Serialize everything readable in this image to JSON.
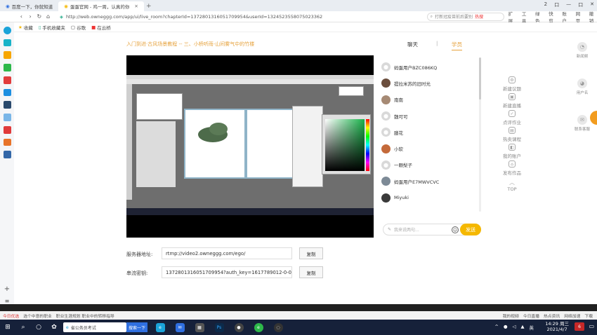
{
  "browser": {
    "tabs": [
      {
        "label": "百度一下，你就知道",
        "active": false
      },
      {
        "label": "蛋蛋官网 - 鸡一周，认真的你",
        "active": true
      }
    ],
    "window_controls": [
      "2",
      "口",
      "—",
      "口",
      "✕"
    ],
    "url": "http://web.owneggg.com/app/ui/live_room?chapterId=1372801316051709954&userId=1324523558075023362",
    "search_placeholder": "打新冠疫苗前后要别",
    "search_tag": "热搜",
    "toolbar_items": [
      "扩展",
      "工具",
      "绿色",
      "快剪",
      "账户",
      "网页",
      "撤销"
    ],
    "bookmarks": [
      "收藏",
      "手机收藏夹",
      "谷歌",
      "在云桥"
    ]
  },
  "lesson": {
    "title": "入门到进·古风场景教程 -- 三、小桥听雨-山间雾气中的竹楼",
    "tabs": {
      "chat": "聊天",
      "separator": "|",
      "students": "学员"
    }
  },
  "students": [
    {
      "name": "蚂蛋用户BZC086KQ",
      "avatar_color": "#d9d9d9"
    },
    {
      "name": "提拉米苏的旧时光",
      "avatar_color": "#6b4e3d"
    },
    {
      "name": "南南",
      "avatar_color": "#a68a74"
    },
    {
      "name": "魏可可",
      "avatar_color": "#d9d9d9"
    },
    {
      "name": "膳花",
      "avatar_color": "#d9d9d9"
    },
    {
      "name": "小软",
      "avatar_color": "#c46a3a"
    },
    {
      "name": "一颗梨子",
      "avatar_color": "#d9d9d9"
    },
    {
      "name": "蚂蛋用户E7MWVCVC",
      "avatar_color": "#7d8a96"
    },
    {
      "name": "Miyuki",
      "avatar_color": "#3a3a3a"
    }
  ],
  "chat_input": {
    "placeholder": "我来说两句...",
    "send_label": "发送",
    "emoji": "☺"
  },
  "right_menu": [
    {
      "label": "新建议题",
      "icon": "gear-icon",
      "glyph": "⚙"
    },
    {
      "label": "新建直播",
      "icon": "live-icon",
      "glyph": "▣"
    },
    {
      "label": "点评作业",
      "icon": "check-icon",
      "glyph": "✓"
    },
    {
      "label": "热卖课程",
      "icon": "bag-icon",
      "glyph": "▤"
    },
    {
      "label": "我的账户",
      "icon": "wallet-icon",
      "glyph": "◧"
    },
    {
      "label": "发布作品",
      "icon": "upload-icon",
      "glyph": "⌂"
    },
    {
      "label": "TOP",
      "icon": "top-arrow-icon",
      "glyph": "︿"
    }
  ],
  "far_right": [
    {
      "label": "新闻频",
      "glyph": "◔"
    },
    {
      "label": "用户名",
      "glyph": "◕"
    },
    {
      "label": "联系客服",
      "glyph": "✉"
    }
  ],
  "server": {
    "address_label": "服务器地址:",
    "address_value": "rtmp://video2.owneggg.com/ego/",
    "key_label": "串流密钥:",
    "key_value": "1372801316051709954?auth_key=1617789012-0-0-8c",
    "copy_label": "复制"
  },
  "status_bar": {
    "left_items": [
      "今日优选",
      "选个中意的职业",
      "职业生涯规划 职业中的转移指导"
    ],
    "right_items": [
      "我的视频",
      "今日直播",
      "热点资讯",
      "网络加速",
      "下载"
    ]
  },
  "taskbar": {
    "search_text": "省公务员考试",
    "search_btn": "搜索一下",
    "time": "14:29 周三",
    "date": "2021/4/7",
    "ime": "英",
    "notifications": "6"
  },
  "colors": {
    "accent": "#e6a23c",
    "send": "#f5b800",
    "taskbar": "#16213a"
  }
}
